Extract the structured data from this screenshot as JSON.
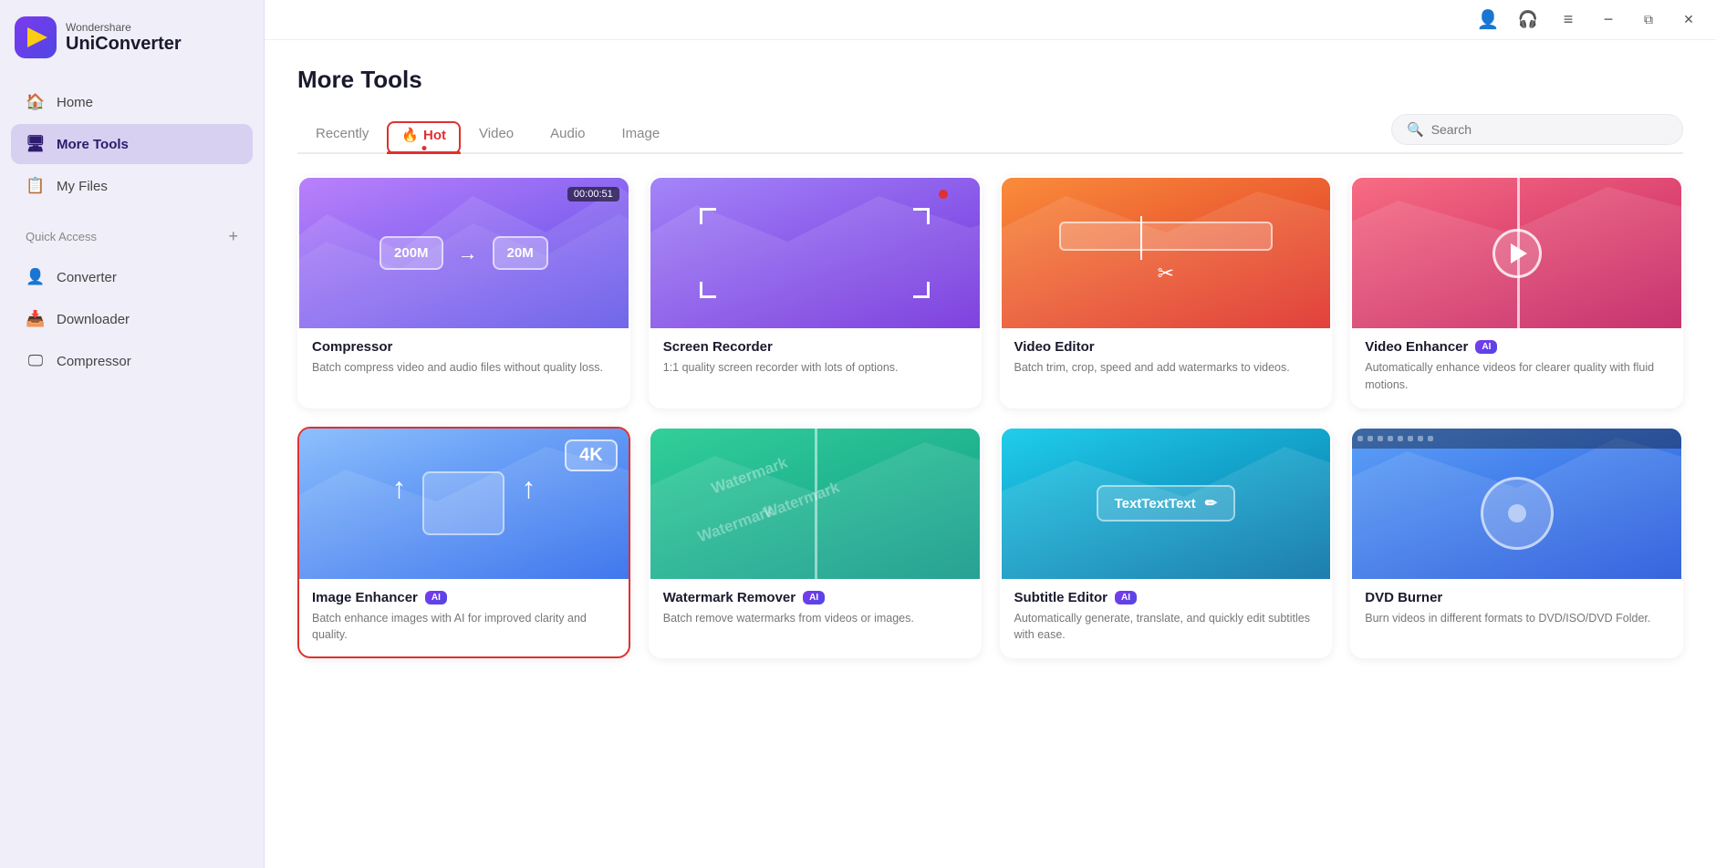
{
  "app": {
    "title": "Wondershare UniConverter",
    "logo_top": "Wondershare",
    "logo_bottom": "UniConverter"
  },
  "titlebar": {
    "minimize_label": "−",
    "restore_label": "⧉",
    "close_label": "✕"
  },
  "sidebar": {
    "nav_items": [
      {
        "id": "home",
        "label": "Home",
        "icon": "🏠"
      },
      {
        "id": "more-tools",
        "label": "More Tools",
        "icon": "🖥"
      },
      {
        "id": "my-files",
        "label": "My Files",
        "icon": "📋"
      }
    ],
    "quick_access_label": "Quick Access",
    "quick_access_plus": "+",
    "sub_items": [
      {
        "id": "converter",
        "label": "Converter",
        "icon": "👤"
      },
      {
        "id": "downloader",
        "label": "Downloader",
        "icon": "📥"
      },
      {
        "id": "compressor",
        "label": "Compressor",
        "icon": "🖵"
      }
    ]
  },
  "page": {
    "title": "More Tools"
  },
  "tabs": [
    {
      "id": "recently",
      "label": "Recently",
      "active": false
    },
    {
      "id": "hot",
      "label": "🔥 Hot",
      "active": true
    },
    {
      "id": "video",
      "label": "Video",
      "active": false
    },
    {
      "id": "audio",
      "label": "Audio",
      "active": false
    },
    {
      "id": "image",
      "label": "Image",
      "active": false
    }
  ],
  "search": {
    "placeholder": "Search"
  },
  "tools": [
    {
      "id": "compressor",
      "name": "Compressor",
      "desc": "Batch compress video and audio files without quality loss.",
      "ai": false,
      "selected": false,
      "thumb_type": "compressor",
      "timestamp": "00:00:51",
      "compress_from": "200M",
      "compress_to": "20M"
    },
    {
      "id": "screen-recorder",
      "name": "Screen Recorder",
      "desc": "1:1 quality screen recorder with lots of options.",
      "ai": false,
      "selected": false,
      "thumb_type": "screen"
    },
    {
      "id": "video-editor",
      "name": "Video Editor",
      "desc": "Batch trim, crop, speed and add watermarks to videos.",
      "ai": false,
      "selected": false,
      "thumb_type": "video-editor"
    },
    {
      "id": "video-enhancer",
      "name": "Video Enhancer",
      "desc": "Automatically enhance videos for clearer quality with fluid motions.",
      "ai": true,
      "selected": false,
      "thumb_type": "video-enhancer"
    },
    {
      "id": "image-enhancer",
      "name": "Image Enhancer",
      "desc": "Batch enhance images with AI for improved clarity and quality.",
      "ai": true,
      "selected": true,
      "thumb_type": "image-enhancer"
    },
    {
      "id": "watermark-remover",
      "name": "Watermark Remover",
      "desc": "Batch remove watermarks from videos or images.",
      "ai": true,
      "selected": false,
      "thumb_type": "watermark"
    },
    {
      "id": "subtitle-editor",
      "name": "Subtitle Editor",
      "desc": "Automatically generate, translate, and quickly edit subtitles with ease.",
      "ai": true,
      "selected": false,
      "thumb_type": "subtitle"
    },
    {
      "id": "dvd-burner",
      "name": "DVD Burner",
      "desc": "Burn videos in different formats to DVD/ISO/DVD Folder.",
      "ai": false,
      "selected": false,
      "thumb_type": "dvd"
    }
  ]
}
